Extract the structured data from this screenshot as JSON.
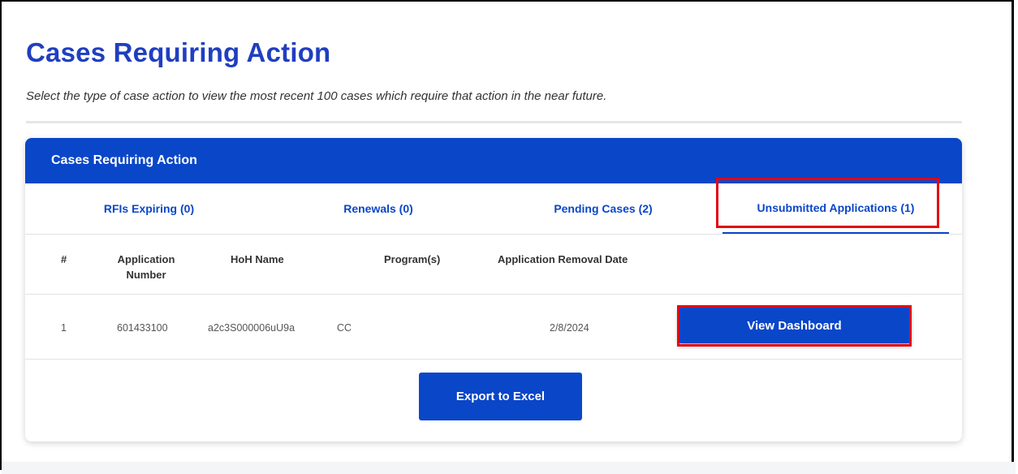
{
  "page": {
    "title": "Cases Requiring Action",
    "subtitle": "Select the type of case action to view the most recent 100 cases which require that action in the near future."
  },
  "card": {
    "header": "Cases Requiring Action",
    "tabs": [
      {
        "label": "RFIs Expiring (0)",
        "active": false
      },
      {
        "label": "Renewals (0)",
        "active": false
      },
      {
        "label": "Pending Cases (2)",
        "active": false
      },
      {
        "label": "Unsubmitted Applications (1)",
        "active": true
      }
    ],
    "columns": [
      "#",
      "Application Number",
      "HoH Name",
      "Program(s)",
      "Application Removal Date"
    ],
    "rows": [
      {
        "index": "1",
        "application_number": "601433100",
        "hoh_name": "a2c3S000006uU9a",
        "programs": "CC",
        "removal_date": "2/8/2024",
        "action_label": "View Dashboard"
      }
    ],
    "export_label": "Export to Excel"
  },
  "colors": {
    "primary": "#0a46c8",
    "title": "#1f3fbf",
    "highlight": "#e30613"
  }
}
